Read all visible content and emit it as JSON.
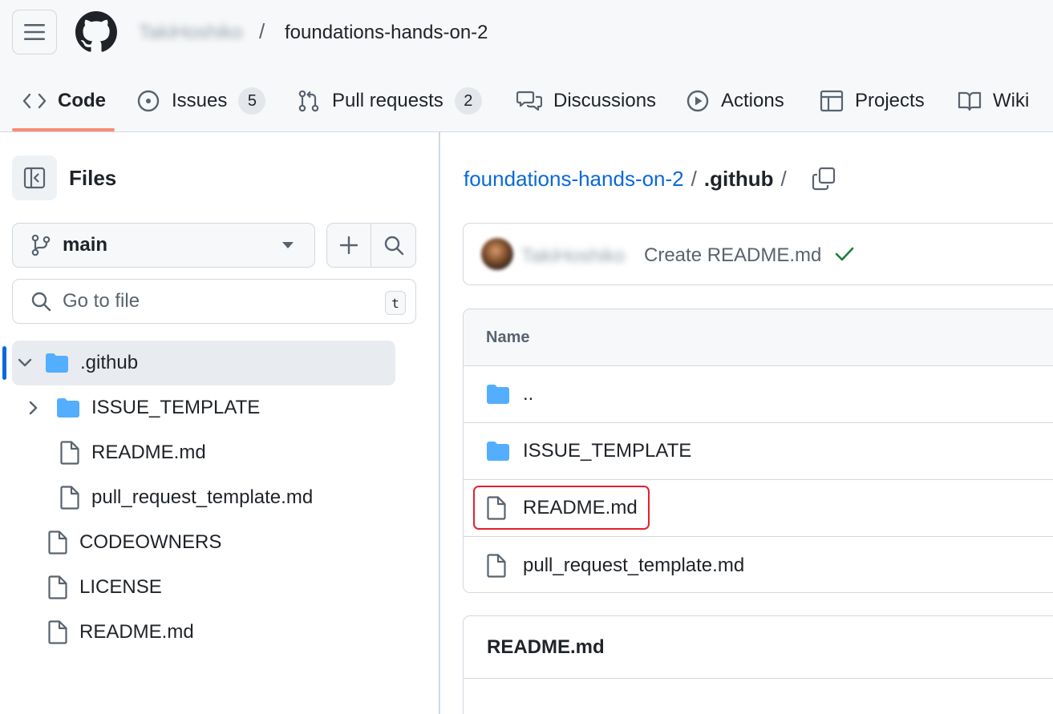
{
  "header": {
    "owner": "TakiHoshiko",
    "separator": "/",
    "repo_name": "foundations-hands-on-2"
  },
  "nav_tabs": [
    {
      "label": "Code",
      "icon": "code-icon",
      "active": true
    },
    {
      "label": "Issues",
      "icon": "issue-opened-icon",
      "count": "5"
    },
    {
      "label": "Pull requests",
      "icon": "git-pull-request-icon",
      "count": "2"
    },
    {
      "label": "Discussions",
      "icon": "comment-discussion-icon"
    },
    {
      "label": "Actions",
      "icon": "play-icon"
    },
    {
      "label": "Projects",
      "icon": "table-icon"
    },
    {
      "label": "Wiki",
      "icon": "book-icon"
    }
  ],
  "sidebar": {
    "title": "Files",
    "branch": "main",
    "search_placeholder": "Go to file",
    "shortcut_key": "t",
    "tree": [
      {
        "label": ".github",
        "type": "folder",
        "expanded": true,
        "selected": true
      },
      {
        "label": "ISSUE_TEMPLATE",
        "type": "folder",
        "expanded": false
      },
      {
        "label": "README.md",
        "type": "file"
      },
      {
        "label": "pull_request_template.md",
        "type": "file"
      },
      {
        "label": "CODEOWNERS",
        "type": "file"
      },
      {
        "label": "LICENSE",
        "type": "file"
      },
      {
        "label": "README.md",
        "type": "file"
      }
    ]
  },
  "main": {
    "breadcrumb": {
      "repo": "foundations-hands-on-2",
      "slash": "/",
      "current": ".github"
    },
    "latest_commit": {
      "author": "TakiHoshiko",
      "message": "Create README.md",
      "status": "success"
    },
    "file_table": {
      "header": "Name",
      "rows": [
        {
          "name": "..",
          "type": "folder"
        },
        {
          "name": "ISSUE_TEMPLATE",
          "type": "folder"
        },
        {
          "name": "README.md",
          "type": "file",
          "highlighted": true
        },
        {
          "name": "pull_request_template.md",
          "type": "file"
        }
      ]
    },
    "readme_title": "README.md"
  },
  "colors": {
    "accent_blue": "#0969da",
    "folder_blue": "#54aeff",
    "active_tab_underline": "#fd8c73",
    "highlight_red": "#e5212d",
    "success_green": "#1a7f37"
  }
}
